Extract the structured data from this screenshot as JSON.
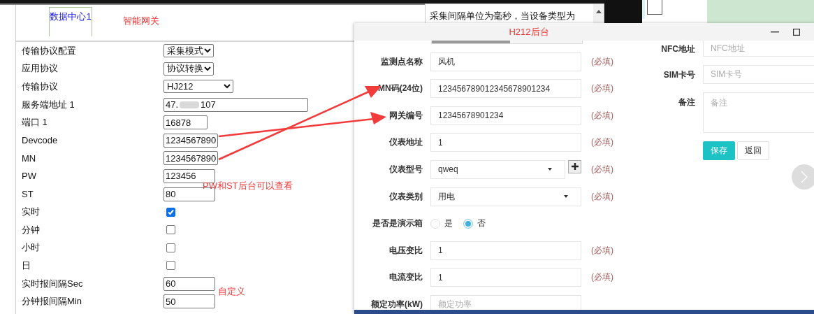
{
  "gateway_page": {
    "tabs": [
      {
        "label": "数据中心1",
        "selected": true
      }
    ],
    "title": "智能网关",
    "fields": [
      {
        "label": "传输协议配置",
        "kind": "select",
        "value": "采集模式"
      },
      {
        "label": "应用协议",
        "kind": "select",
        "value": "协议转换"
      },
      {
        "label": "传输协议",
        "kind": "select",
        "value": "HJ212"
      },
      {
        "label": "服务端地址 1",
        "kind": "redacted",
        "value_parts": [
          "47.",
          "107"
        ]
      },
      {
        "label": "端口 1",
        "kind": "input",
        "value": "16878"
      },
      {
        "label": "Devcode",
        "kind": "input",
        "value": "1234567890"
      },
      {
        "label": "MN",
        "kind": "input",
        "value": "1234567890"
      },
      {
        "label": "PW",
        "kind": "input",
        "value": "123456"
      },
      {
        "label": "ST",
        "kind": "input",
        "value": "80"
      },
      {
        "label": "实时",
        "kind": "checkbox",
        "checked": true
      },
      {
        "label": "分钟",
        "kind": "checkbox",
        "checked": false
      },
      {
        "label": "小时",
        "kind": "checkbox",
        "checked": false
      },
      {
        "label": "日",
        "kind": "checkbox",
        "checked": false
      },
      {
        "label": "实时报间隔Sec",
        "kind": "input",
        "value": "60"
      },
      {
        "label": "分钟报间隔Min",
        "kind": "input",
        "value": "50"
      }
    ]
  },
  "tooltip": {
    "text": "采集间隔单位为毫秒，当设备类型为"
  },
  "window": {
    "title": "H212后台",
    "left_fields": [
      {
        "label": "监测点名称",
        "kind": "input",
        "value": "风机",
        "note": "(必填)"
      },
      {
        "label": "MN码(24位)",
        "kind": "input",
        "value": "123456789012345678901234",
        "note": "(必填)"
      },
      {
        "label": "网关编号",
        "kind": "input",
        "value": "12345678901234",
        "note": "(必填)"
      },
      {
        "label": "仪表地址",
        "kind": "input",
        "value": "1",
        "note": "(必填)"
      },
      {
        "label": "仪表型号",
        "kind": "select_add",
        "value": "qweq",
        "note": "(必填)"
      },
      {
        "label": "仪表类别",
        "kind": "select",
        "value": "用电",
        "note": "(必填)"
      },
      {
        "label": "是否是演示箱",
        "kind": "radio",
        "options": [
          {
            "label": "是",
            "selected": false
          },
          {
            "label": "否",
            "selected": true
          }
        ]
      },
      {
        "label": "电压变比",
        "kind": "input",
        "value": "1",
        "note": "(必填)"
      },
      {
        "label": "电流变比",
        "kind": "input",
        "value": "1",
        "note": "(必填)"
      },
      {
        "label": "额定功率(kW)",
        "kind": "input",
        "placeholder": "额定功率"
      }
    ],
    "right_fields": [
      {
        "label": "NFC地址",
        "kind": "input",
        "placeholder": "NFC地址"
      },
      {
        "label": "SIM卡号",
        "kind": "input",
        "placeholder": "SIM卡号"
      },
      {
        "label": "备注",
        "kind": "textarea",
        "placeholder": "备注"
      }
    ],
    "buttons": [
      {
        "label": "保存",
        "kind": "primary"
      },
      {
        "label": "返回",
        "kind": "default"
      }
    ]
  },
  "annotations": [
    {
      "text": "PW和ST后台可以查看"
    },
    {
      "text": "自定义"
    }
  ]
}
